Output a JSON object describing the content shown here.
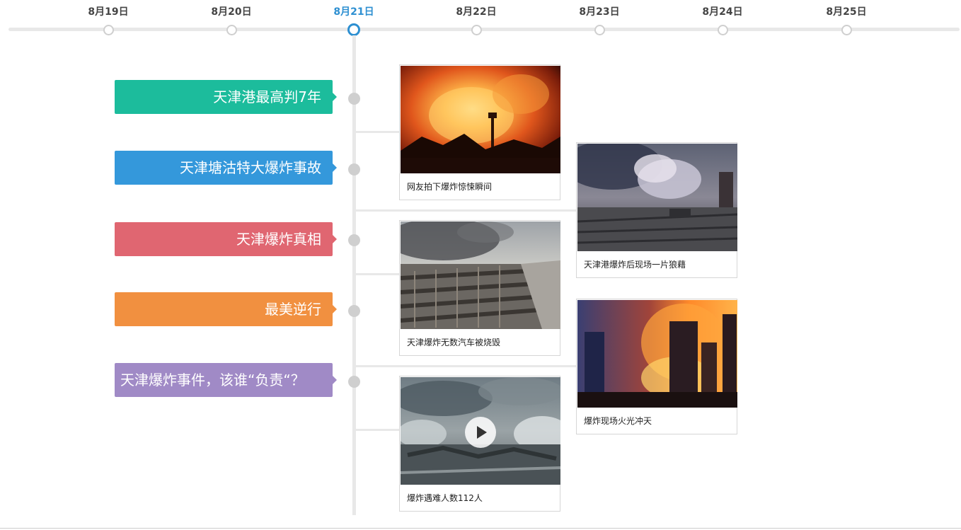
{
  "timeline": {
    "dates": [
      {
        "label": "8月19日",
        "active": false
      },
      {
        "label": "8月20日",
        "active": false
      },
      {
        "label": "8月21日",
        "active": true
      },
      {
        "label": "8月22日",
        "active": false
      },
      {
        "label": "8月23日",
        "active": false
      },
      {
        "label": "8月24日",
        "active": false
      },
      {
        "label": "8月25日",
        "active": false
      }
    ],
    "active_color": "#2d8fd1"
  },
  "topics": [
    {
      "label": "天津港最高判7年",
      "color": "#1cbc9c"
    },
    {
      "label": "天津塘沽特大爆炸事故",
      "color": "#3498db"
    },
    {
      "label": "天津爆炸真相",
      "color": "#e06671"
    },
    {
      "label": "最美逆行",
      "color": "#f19040"
    },
    {
      "label": "天津爆炸事件，该谁“负责“？",
      "color": "#a08ac6"
    }
  ],
  "cards": [
    {
      "caption": "网友拍下爆炸惊悚瞬间",
      "image": "explosion-fireball",
      "video": false
    },
    {
      "caption": "天津港爆炸后现场一片狼藉",
      "image": "smoke-debris",
      "video": false
    },
    {
      "caption": "天津爆炸无数汽车被烧毁",
      "image": "burnt-cars",
      "video": false
    },
    {
      "caption": "爆炸现场火光冲天",
      "image": "fire-buildings",
      "video": false
    },
    {
      "caption": "爆炸遇难人数112人",
      "image": "aerial-ruins",
      "video": true
    }
  ]
}
